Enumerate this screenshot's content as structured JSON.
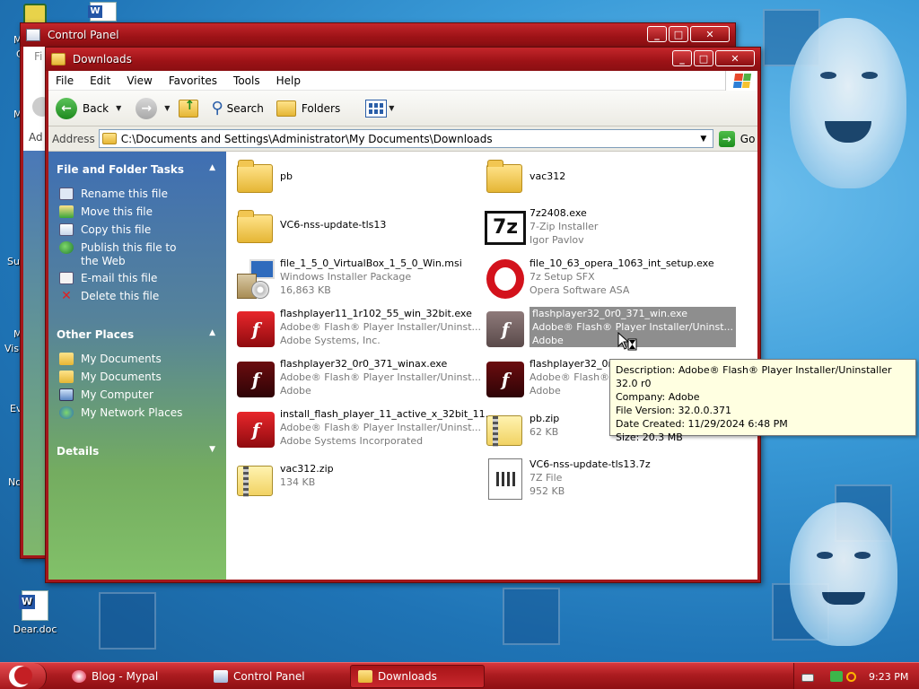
{
  "desktop": {
    "icons": [
      {
        "label": "Dear.doc"
      }
    ],
    "edge_labels": [
      "M",
      "C",
      "M",
      "Se",
      "Su",
      "M",
      "Vis",
      "Ev",
      "No",
      "Ad"
    ]
  },
  "control_panel_window": {
    "title": "Control Panel",
    "fragment_fi": "Fi"
  },
  "downloads_window": {
    "title": "Downloads",
    "menu": [
      "File",
      "Edit",
      "View",
      "Favorites",
      "Tools",
      "Help"
    ],
    "toolbar": {
      "back": "Back",
      "search": "Search",
      "folders": "Folders"
    },
    "address": {
      "label": "Address",
      "path": "C:\\Documents and Settings\\Administrator\\My Documents\\Downloads",
      "go": "Go"
    },
    "taskpane": {
      "file_folder_tasks": {
        "title": "File and Folder Tasks",
        "items": [
          "Rename this file",
          "Move this file",
          "Copy this file",
          "Publish this file to the Web",
          "E-mail this file",
          "Delete this file"
        ]
      },
      "other_places": {
        "title": "Other Places",
        "items": [
          "My Documents",
          "My Documents",
          "My Computer",
          "My Network Places"
        ]
      },
      "details": {
        "title": "Details"
      }
    },
    "files": [
      {
        "name": "pb",
        "line2": "",
        "line3": "",
        "icon": "folder-icon"
      },
      {
        "name": "vac312",
        "line2": "",
        "line3": "",
        "icon": "folder-icon"
      },
      {
        "name": "VC6-nss-update-tls13",
        "line2": "",
        "line3": "",
        "icon": "folder-icon"
      },
      {
        "name": "7z2408.exe",
        "line2": "7-Zip Installer",
        "line3": "Igor Pavlov",
        "icon": "7zip-icon"
      },
      {
        "name": "file_1_5_0_VirtualBox_1_5_0_Win.msi",
        "line2": "Windows Installer Package",
        "line3": "16,863 KB",
        "icon": "msi-installer-icon"
      },
      {
        "name": "file_10_63_opera_1063_int_setup.exe",
        "line2": "7z Setup SFX",
        "line3": "Opera Software ASA",
        "icon": "opera-icon"
      },
      {
        "name": "flashplayer11_1r102_55_win_32bit.exe",
        "line2": "Adobe® Flash® Player Installer/Uninst...",
        "line3": "Adobe Systems, Inc.",
        "icon": "flash-icon"
      },
      {
        "name": "flashplayer32_0r0_371_win.exe",
        "line2": "Adobe® Flash® Player Installer/Uninst...",
        "line3": "Adobe",
        "icon": "flash-icon"
      },
      {
        "name": "flashplayer32_0r0_371_winax.exe",
        "line2": "Adobe® Flash® Player Installer/Uninst...",
        "line3": "Adobe",
        "icon": "flash-icon"
      },
      {
        "name": "flashplayer32_0r0_371_winpep.exe",
        "line2": "Adobe® Flash® Player Installer/Uninst...",
        "line3": "Adobe",
        "icon": "flash-icon"
      },
      {
        "name": "install_flash_player_11_active_x_32bit_11...",
        "line2": "Adobe® Flash® Player Installer/Uninst...",
        "line3": "Adobe Systems Incorporated",
        "icon": "flash-icon"
      },
      {
        "name": "pb.zip",
        "line2": "62 KB",
        "line3": "",
        "icon": "zip-icon"
      },
      {
        "name": "vac312.zip",
        "line2": "134 KB",
        "line3": "",
        "icon": "zip-icon"
      },
      {
        "name": "VC6-nss-update-tls13.7z",
        "line2": "7Z File",
        "line3": "952 KB",
        "icon": "7z-file-icon"
      }
    ],
    "selected_file_index": 7,
    "tooltip": {
      "description": "Description: Adobe® Flash® Player Installer/Uninstaller 32.0 r0",
      "company": "Company: Adobe",
      "file_version": "File Version: 32.0.0.371",
      "date_created": "Date Created: 11/29/2024 6:48 PM",
      "size": "Size: 20.3 MB"
    }
  },
  "taskbar": {
    "buttons": [
      {
        "label": "Blog - Mypal",
        "active": false
      },
      {
        "label": "Control Panel",
        "active": false
      },
      {
        "label": "Downloads",
        "active": true
      }
    ],
    "clock": "9:23 PM"
  },
  "colors": {
    "window_frame": "#a3161a",
    "taskbar": "#ac1c20",
    "taskpane_top": "#3f6fb3",
    "taskpane_bottom": "#82c169",
    "tooltip_bg": "#ffffe1",
    "selection": "#8e8e8e"
  }
}
